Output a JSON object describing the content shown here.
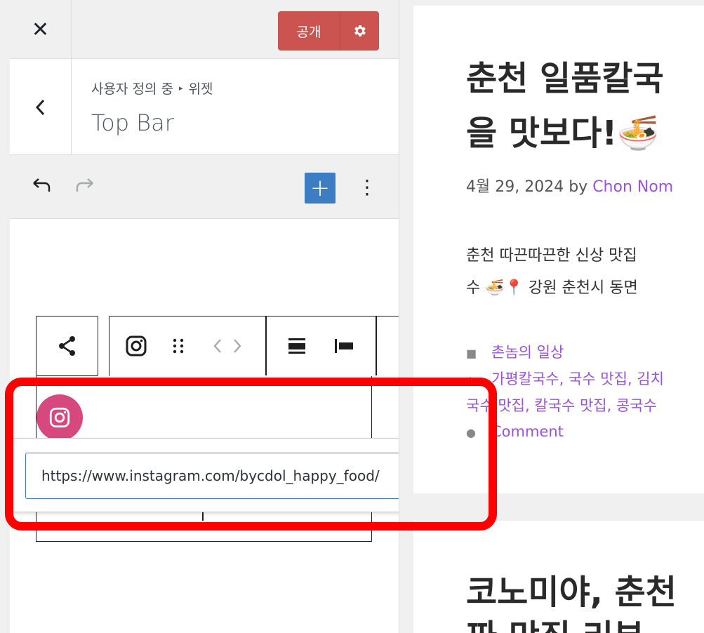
{
  "header": {
    "close_label": "✕",
    "publish_label": "공개"
  },
  "section": {
    "breadcrumb_part1": "사용자 정의 중",
    "breadcrumb_sep": "▸",
    "breadcrumb_part2": "위젯",
    "title": "Top Bar"
  },
  "toolbar": {
    "add_label": "+",
    "options_label": "⋮"
  },
  "link_popover": {
    "url_value": "https://www.instagram.com/bycdol_happy_food/"
  },
  "preview": {
    "post1": {
      "title_line1": "춘천 일품칼국",
      "title_line2": "을 맛보다!🍜",
      "date": "4월 29, 2024",
      "by": " by ",
      "author": "Chon Nom",
      "excerpt_line1": "춘천 따끈따끈한 신상 맛집",
      "excerpt_line2": "수 🍜📍 강원 춘천시 동면",
      "category": "촌놈의 일상",
      "tags_line1": "가평칼국수, 국수 맛집, 김치",
      "tags_line2": "국수 맛집, 칼국수 맛집, 콩국수",
      "comment": "Comment"
    },
    "post2": {
      "title_line1": "코노미야, 춘천",
      "title_line2": "짜 맛집 리뷰"
    }
  },
  "colors": {
    "publish": "#cc5450",
    "accent_blue": "#3c7dc4",
    "instagram": "#d6487e",
    "link": "#9b51e0",
    "highlight": "#ff0000"
  }
}
